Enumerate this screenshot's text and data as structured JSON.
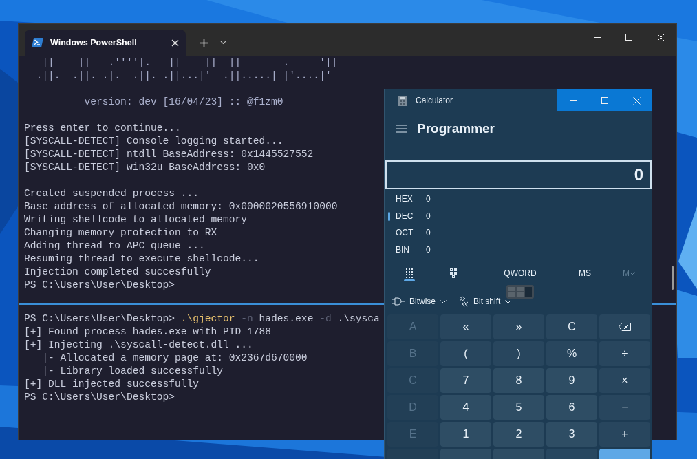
{
  "terminal": {
    "tab": {
      "title": "Windows PowerShell",
      "selected": true
    },
    "panes": [
      {
        "lines": [
          {
            "kind": "art",
            "text": "   ||    ||   .''''|.   ||    ||  ||       .     '||"
          },
          {
            "kind": "art",
            "text": "  .||.  .||. .|.  .||. .||...|'  .||.....| |'....|'"
          },
          {
            "kind": "blank"
          },
          {
            "kind": "art",
            "text": "          version: dev [16/04/23] :: @f1zm0"
          },
          {
            "kind": "blank"
          },
          {
            "kind": "text",
            "text": "Press enter to continue..."
          },
          {
            "kind": "text",
            "text": "[SYSCALL-DETECT] Console logging started..."
          },
          {
            "kind": "text",
            "text": "[SYSCALL-DETECT] ntdll BaseAddress: 0x1445527552"
          },
          {
            "kind": "text",
            "text": "[SYSCALL-DETECT] win32u BaseAddress: 0x0"
          },
          {
            "kind": "blank"
          },
          {
            "kind": "text",
            "text": "Created suspended process ..."
          },
          {
            "kind": "text",
            "text": "Base address of allocated memory: 0x0000020556910000"
          },
          {
            "kind": "text",
            "text": "Writing shellcode to allocated memory"
          },
          {
            "kind": "text",
            "text": "Changing memory protection to RX"
          },
          {
            "kind": "text",
            "text": "Adding thread to APC queue ..."
          },
          {
            "kind": "text",
            "text": "Resuming thread to execute shellcode..."
          },
          {
            "kind": "text",
            "text": "Injection completed succesfully"
          },
          {
            "kind": "text",
            "text": "PS C:\\Users\\User\\Desktop>"
          }
        ]
      },
      {
        "lines": [
          {
            "kind": "command",
            "segments": [
              {
                "kind": "prompt",
                "text": "PS C:\\Users\\User\\Desktop> "
              },
              {
                "kind": "exe",
                "text": ".\\gjector"
              },
              {
                "kind": "flag",
                "text": " -n"
              },
              {
                "kind": "arg",
                "text": " hades.exe"
              },
              {
                "kind": "flag",
                "text": " -d"
              },
              {
                "kind": "arg",
                "text": " .\\sysca"
              }
            ]
          },
          {
            "kind": "text",
            "text": "[+] Found process hades.exe with PID 1788"
          },
          {
            "kind": "text",
            "text": "[+] Injecting .\\syscall-detect.dll ..."
          },
          {
            "kind": "text",
            "text": "   |- Allocated a memory page at: 0x2367d670000"
          },
          {
            "kind": "text",
            "text": "   |- Library loaded successfully"
          },
          {
            "kind": "text",
            "text": "[+] DLL injected successfully"
          },
          {
            "kind": "text",
            "text": "PS C:\\Users\\User\\Desktop>"
          }
        ]
      }
    ]
  },
  "calculator": {
    "title": "Calculator",
    "mode": "Programmer",
    "display": "0",
    "radixes": [
      {
        "label": "HEX",
        "value": "0",
        "selected": false
      },
      {
        "label": "DEC",
        "value": "0",
        "selected": true
      },
      {
        "label": "OCT",
        "value": "0",
        "selected": false
      },
      {
        "label": "BIN",
        "value": "0",
        "selected": false
      }
    ],
    "toolbar": [
      {
        "kind": "keypad",
        "selected": true,
        "disabled": false
      },
      {
        "kind": "bits",
        "selected": false,
        "disabled": false
      },
      {
        "kind": "word",
        "label": "QWORD",
        "selected": false,
        "disabled": false
      },
      {
        "kind": "memory-store",
        "label": "MS",
        "selected": false,
        "disabled": false
      },
      {
        "kind": "memory-list",
        "label": "M",
        "selected": false,
        "disabled": true
      }
    ],
    "menus": [
      {
        "kind": "bitwise",
        "label": "Bitwise"
      },
      {
        "kind": "shift",
        "label": "Bit shift"
      }
    ],
    "keys": [
      {
        "kind": "letter",
        "label": "A",
        "disabled": true
      },
      {
        "kind": "op",
        "label": "«",
        "disabled": false
      },
      {
        "kind": "op",
        "label": "»",
        "disabled": false
      },
      {
        "kind": "op",
        "label": "C",
        "disabled": false
      },
      {
        "kind": "backspace",
        "disabled": false
      },
      {
        "kind": "letter",
        "label": "B",
        "disabled": true
      },
      {
        "kind": "op",
        "label": "(",
        "disabled": false
      },
      {
        "kind": "op",
        "label": ")",
        "disabled": false
      },
      {
        "kind": "op",
        "label": "%",
        "disabled": false
      },
      {
        "kind": "op",
        "label": "÷",
        "disabled": false
      },
      {
        "kind": "letter",
        "label": "C",
        "disabled": true
      },
      {
        "kind": "digit",
        "label": "7",
        "disabled": false
      },
      {
        "kind": "digit",
        "label": "8",
        "disabled": false
      },
      {
        "kind": "digit",
        "label": "9",
        "disabled": false
      },
      {
        "kind": "op",
        "label": "×",
        "disabled": false
      },
      {
        "kind": "letter",
        "label": "D",
        "disabled": true
      },
      {
        "kind": "digit",
        "label": "4",
        "disabled": false
      },
      {
        "kind": "digit",
        "label": "5",
        "disabled": false
      },
      {
        "kind": "digit",
        "label": "6",
        "disabled": false
      },
      {
        "kind": "op",
        "label": "−",
        "disabled": false
      },
      {
        "kind": "letter",
        "label": "E",
        "disabled": true
      },
      {
        "kind": "digit",
        "label": "1",
        "disabled": false
      },
      {
        "kind": "digit",
        "label": "2",
        "disabled": false
      },
      {
        "kind": "digit",
        "label": "3",
        "disabled": false
      },
      {
        "kind": "op",
        "label": "+",
        "disabled": false
      },
      {
        "kind": "letter"
      },
      {
        "kind": "digit"
      },
      {
        "kind": "digit"
      },
      {
        "kind": "empty"
      },
      {
        "kind": "equals"
      }
    ]
  }
}
